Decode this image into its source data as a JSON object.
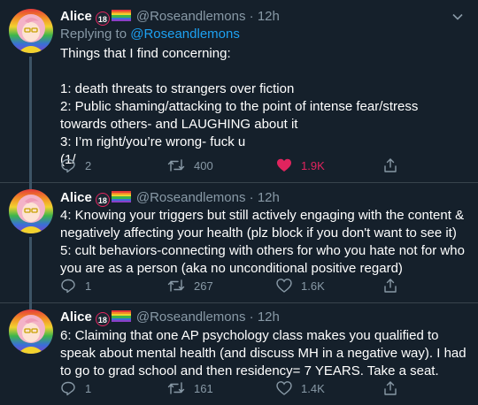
{
  "tweets": [
    {
      "name": "Alice",
      "badge": "18",
      "handle": "@Roseandlemons",
      "time": "12h",
      "reply_prefix": "Replying to",
      "reply_handle": "@Roseandlemons",
      "text": "Things that I find concerning:\n\n1: death threats to strangers over fiction\n2: Public shaming/attacking to the point of intense fear/stress towards others- and LAUGHING about it\n3: I’m right/you’re wrong- fuck u\n(1/",
      "replies": "2",
      "retweets": "400",
      "likes": "1.9K",
      "liked": true
    },
    {
      "name": "Alice",
      "badge": "18",
      "handle": "@Roseandlemons",
      "time": "12h",
      "text": "4: Knowing your triggers but still actively engaging with the content & negatively affecting your health (plz block if you don't want to see it)\n5: cult behaviors-connecting with others for who you hate not for who you are as a person (aka no unconditional positive regard)",
      "replies": "1",
      "retweets": "267",
      "likes": "1.6K",
      "liked": false
    },
    {
      "name": "Alice",
      "badge": "18",
      "handle": "@Roseandlemons",
      "time": "12h",
      "text": "6: Claiming that one AP psychology class makes you qualified to speak about mental health (and discuss MH in a negative way). I had to go to grad school and then residency= 7 YEARS. Take a seat.",
      "replies": "1",
      "retweets": "161",
      "likes": "1.4K",
      "liked": false
    }
  ],
  "colors": {
    "background": "#15202b",
    "accent": "#1da1f2",
    "like": "#e0245e",
    "muted": "#8899a6",
    "divider": "#38444d"
  },
  "icons": [
    "reply-icon",
    "retweet-icon",
    "like-icon",
    "share-icon",
    "chevron-down-icon",
    "rainbow-flag-icon",
    "age-18-badge-icon"
  ]
}
